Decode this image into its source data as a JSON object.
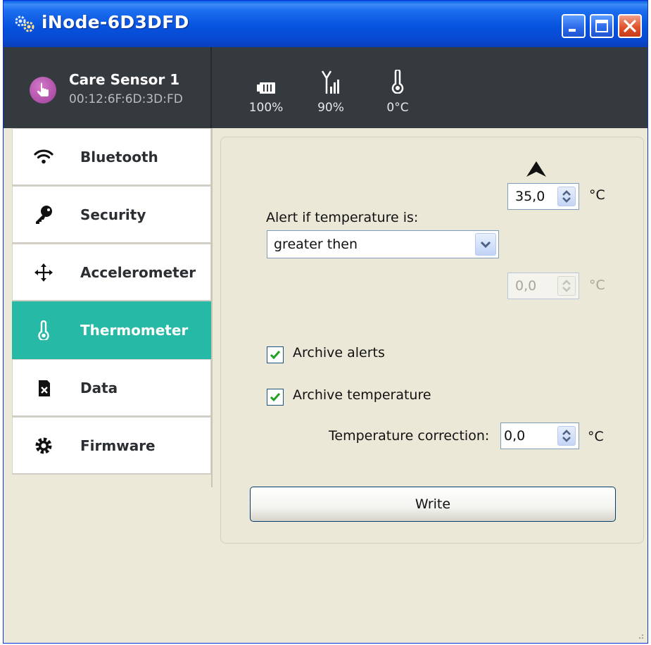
{
  "window": {
    "title": "iNode-6D3DFD",
    "titlebar_color": "#0a52dc",
    "close_color": "#e0532d"
  },
  "device": {
    "name": "Care Sensor 1",
    "mac": "00:12:6F:6D:3D:FD",
    "avatar_color": "#b04fac"
  },
  "status": {
    "battery": "100%",
    "signal": "90%",
    "temperature": "0°C"
  },
  "sidebar": {
    "active_color": "#26b9a6",
    "items": [
      {
        "label": "Bluetooth",
        "icon": "wifi-icon"
      },
      {
        "label": "Security",
        "icon": "key-icon"
      },
      {
        "label": "Accelerometer",
        "icon": "move-arrows-icon"
      },
      {
        "label": "Thermometer",
        "icon": "thermometer-icon",
        "active": true
      },
      {
        "label": "Data",
        "icon": "sd-card-icon"
      },
      {
        "label": "Firmware",
        "icon": "gear-icon"
      }
    ]
  },
  "thermometer": {
    "alert_label": "Alert if temperature is:",
    "condition": "greater then",
    "upper_value": "35,0",
    "upper_unit": "°C",
    "lower_value": "0,0",
    "lower_unit": "°C",
    "archive_alerts_label": "Archive alerts",
    "archive_alerts_checked": true,
    "archive_temperature_label": "Archive temperature",
    "archive_temperature_checked": true,
    "correction_label": "Temperature correction:",
    "correction_value": "0,0",
    "correction_unit": "°C",
    "write_label": "Write"
  }
}
